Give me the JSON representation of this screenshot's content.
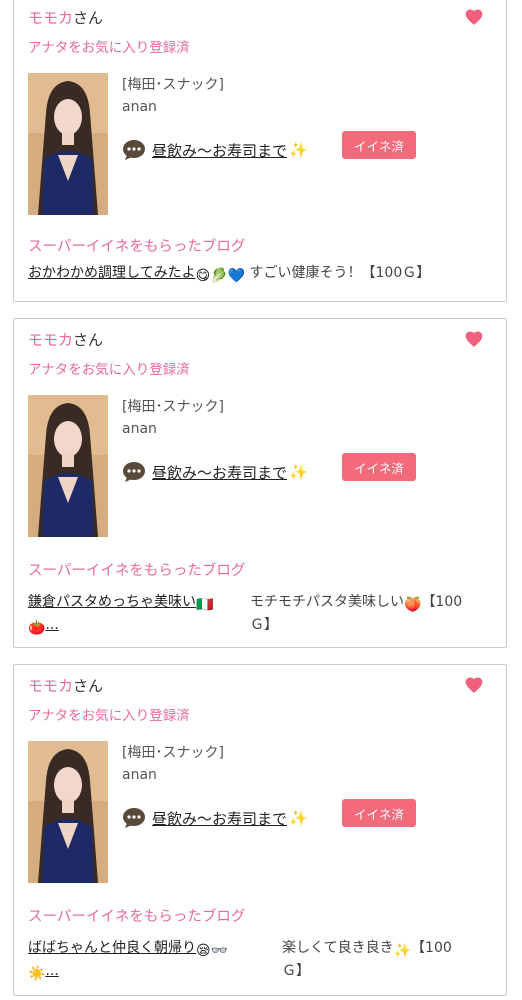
{
  "cards": [
    {
      "name": "モモカ",
      "honorific": "さん",
      "favorite_status": "アナタをお気に入り登録済",
      "shop": "[梅田･スナック]",
      "cast_id": "anan",
      "message_title": "昼飲み〜お寿司まで",
      "like_button": "イイネ済",
      "super_like_heading": "スーパーイイネをもらったブログ",
      "blog_title": "おかわかめ調理してみたよ",
      "blog_comment": "すごい健康そう！【100Ｇ】"
    },
    {
      "name": "モモカ",
      "honorific": "さん",
      "favorite_status": "アナタをお気に入り登録済",
      "shop": "[梅田･スナック]",
      "cast_id": "anan",
      "message_title": "昼飲み〜お寿司まで",
      "like_button": "イイネ済",
      "super_like_heading": "スーパーイイネをもらったブログ",
      "blog_title": "鎌倉パスタめっちゃ美味い",
      "blog_title_cont": "...",
      "blog_comment": "モチモチパスタ美味しい",
      "blog_comment_cont": "【100",
      "blog_comment_end": "Ｇ】"
    },
    {
      "name": "モモカ",
      "honorific": "さん",
      "favorite_status": "アナタをお気に入り登録済",
      "shop": "[梅田･スナック]",
      "cast_id": "anan",
      "message_title": "昼飲み〜お寿司まで",
      "like_button": "イイネ済",
      "super_like_heading": "スーパーイイネをもらったブログ",
      "blog_title": "ばばちゃんと仲良く朝帰り",
      "blog_title_cont": "...",
      "blog_comment": "楽しくて良き良き",
      "blog_comment_cont": "【100",
      "blog_comment_end": "Ｇ】"
    }
  ],
  "colors": {
    "pink_text": "#e96a9e",
    "heart": "#f0607d",
    "like_button_bg": "#f36a7b"
  },
  "icons": [
    "heart-icon",
    "speech-bubble-icon",
    "sparkle-icon"
  ]
}
